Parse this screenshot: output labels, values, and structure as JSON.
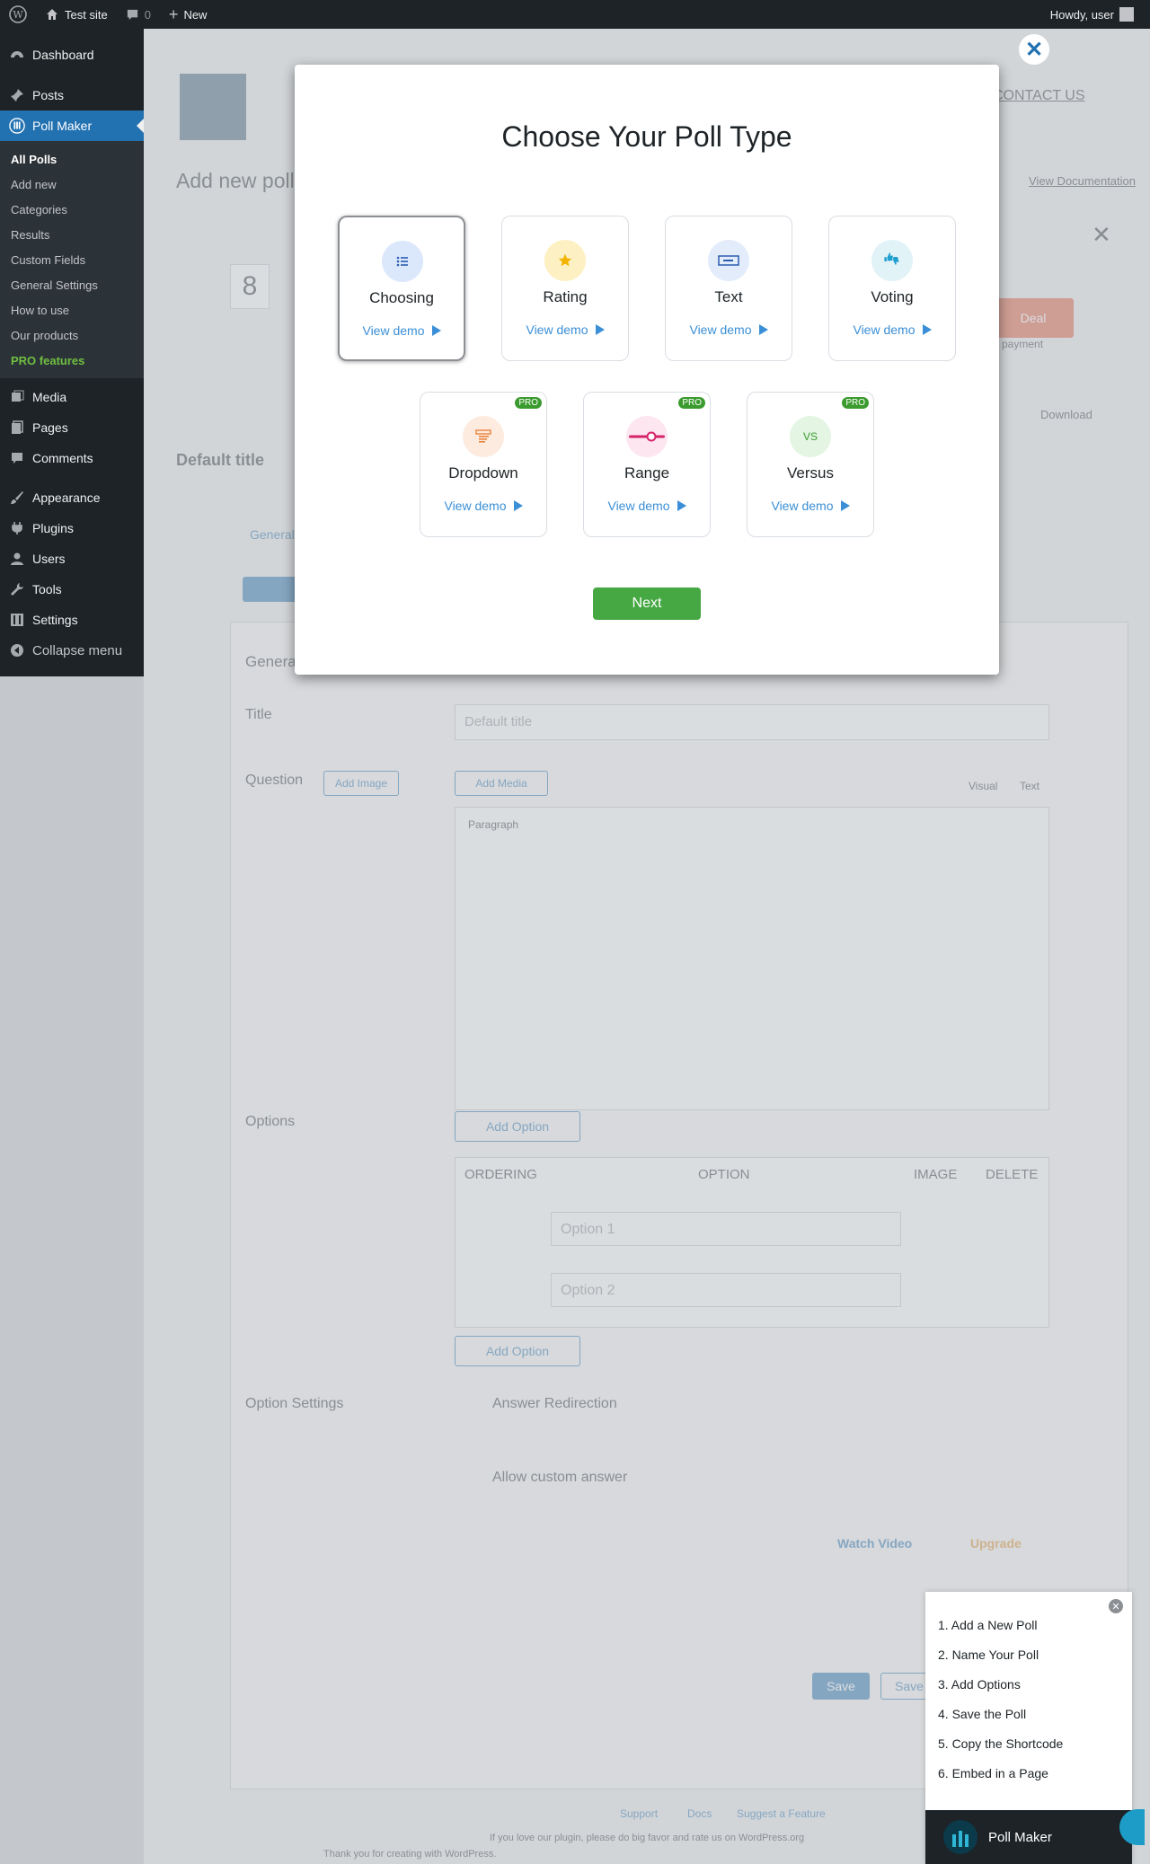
{
  "adminbar": {
    "site_name": "Test site",
    "comments_count": "0",
    "new_label": "New",
    "howdy": "Howdy, user"
  },
  "sidebar": {
    "items": [
      {
        "label": "Dashboard",
        "icon": "dashboard-icon"
      },
      {
        "label": "Posts",
        "icon": "pin-icon"
      },
      {
        "label": "Poll Maker",
        "icon": "poll-maker-icon"
      }
    ],
    "submenu": [
      "All Polls",
      "Add new",
      "Categories",
      "Results",
      "Custom Fields",
      "General Settings",
      "How to use",
      "Our products",
      "PRO features"
    ],
    "items_after": [
      {
        "label": "Media",
        "icon": "media-icon"
      },
      {
        "label": "Pages",
        "icon": "pages-icon"
      },
      {
        "label": "Comments",
        "icon": "comment-icon"
      },
      {
        "label": "Appearance",
        "icon": "brush-icon"
      },
      {
        "label": "Plugins",
        "icon": "plugin-icon"
      },
      {
        "label": "Users",
        "icon": "user-icon"
      },
      {
        "label": "Tools",
        "icon": "wrench-icon"
      },
      {
        "label": "Settings",
        "icon": "settings-icon"
      },
      {
        "label": "Collapse menu",
        "icon": "collapse-icon"
      }
    ]
  },
  "background": {
    "page_title": "Add new poll",
    "contact": "CONTACT US",
    "view_documentation": "View Documentation",
    "countdown_digit": "8",
    "deal": "Deal",
    "payment": "payment",
    "download": "Download",
    "default_title_heading": "Default title",
    "general_tab": "General",
    "general_heading": "General",
    "title_label": "Title",
    "title_placeholder": "Default title",
    "question_label": "Question",
    "add_image": "Add Image",
    "add_media": "Add Media",
    "visual_tab": "Visual",
    "text_tab": "Text",
    "paragraph": "Paragraph",
    "options_label": "Options",
    "add_option": "Add Option",
    "cols": [
      "ORDERING",
      "OPTION",
      "IMAGE",
      "DELETE"
    ],
    "option1": "Option 1",
    "option2": "Option 2",
    "option_settings": "Option Settings",
    "answer_redirection": "Answer Redirection",
    "allow_custom": "Allow custom answer",
    "watch_video": "Watch Video",
    "upgrade": "Upgrade",
    "save": "Save",
    "save_close": "Save",
    "footer_links": [
      "Support",
      "Docs",
      "Suggest a Feature"
    ],
    "footer_rate": "If you love our plugin, please do big favor and rate us on WordPress.org",
    "footer_thanks": "Thank you for creating with WordPress."
  },
  "modal": {
    "title": "Choose Your Poll Type",
    "view_demo": "View demo",
    "pro_badge": "PRO",
    "cards": [
      {
        "name": "Choosing",
        "icon": "list-icon",
        "color": "#dbe8fb",
        "pro": false,
        "selected": true
      },
      {
        "name": "Rating",
        "icon": "star-icon",
        "color": "#fdf0c2",
        "pro": false,
        "selected": false
      },
      {
        "name": "Text",
        "icon": "text-field-icon",
        "color": "#e3ecfa",
        "pro": false,
        "selected": false
      },
      {
        "name": "Voting",
        "icon": "thumbs-icon",
        "color": "#e2f3f8",
        "pro": false,
        "selected": false
      },
      {
        "name": "Dropdown",
        "icon": "dropdown-icon",
        "color": "#fdebe0",
        "pro": true,
        "selected": false
      },
      {
        "name": "Range",
        "icon": "slider-icon",
        "color": "#fde6ef",
        "pro": true,
        "selected": false
      },
      {
        "name": "Versus",
        "icon": "versus-icon",
        "color": "#e4f5e4",
        "pro": true,
        "selected": false
      }
    ],
    "versus_text": "VS",
    "next": "Next"
  },
  "guide": {
    "steps": [
      "1. Add a New Poll",
      "2. Name Your Poll",
      "3. Add Options",
      "4. Save the Poll",
      "5. Copy the Shortcode",
      "6. Embed in a Page"
    ],
    "brand": "Poll Maker"
  }
}
